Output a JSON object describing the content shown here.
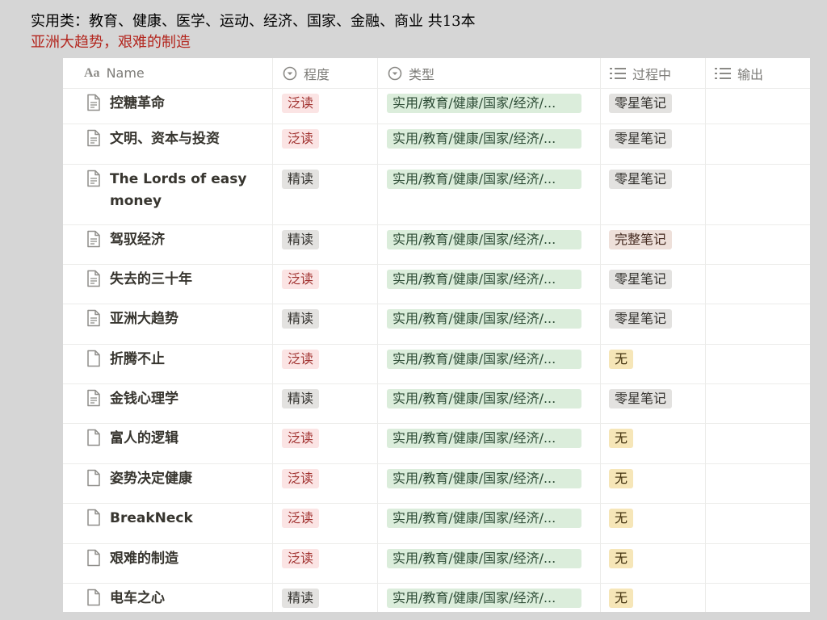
{
  "slide": {
    "title": "实用类：教育、健康、医学、运动、经济、国家、金融、商业 共13本",
    "subtitle": "亚洲大趋势，艰难的制造"
  },
  "columns": {
    "name": "Name",
    "level": "程度",
    "type": "类型",
    "process": "过程中",
    "output": "输出"
  },
  "icons": {
    "name_header": "text-aa-icon",
    "level_header": "select-icon",
    "type_header": "select-icon",
    "process_header": "list-icon",
    "output_header": "list-icon",
    "row": "document-icon"
  },
  "rows": [
    {
      "name": "控糖革命",
      "level": "泛读",
      "type": "实用/教育/健康/国家/经济/...",
      "process": "零星笔记",
      "output": ""
    },
    {
      "name": "文明、资本与投资",
      "level": "泛读",
      "type": "实用/教育/健康/国家/经济/...",
      "process": "零星笔记",
      "output": ""
    },
    {
      "name": "The Lords of easy money",
      "level": "精读",
      "type": "实用/教育/健康/国家/经济/...",
      "process": "零星笔记",
      "output": ""
    },
    {
      "name": "驾驭经济",
      "level": "精读",
      "type": "实用/教育/健康/国家/经济/...",
      "process": "完整笔记",
      "output": ""
    },
    {
      "name": "失去的三十年",
      "level": "泛读",
      "type": "实用/教育/健康/国家/经济/...",
      "process": "零星笔记",
      "output": ""
    },
    {
      "name": "亚洲大趋势",
      "level": "精读",
      "type": "实用/教育/健康/国家/经济/...",
      "process": "零星笔记",
      "output": ""
    },
    {
      "name": "折腾不止",
      "level": "泛读",
      "type": "实用/教育/健康/国家/经济/...",
      "process": "无",
      "output": ""
    },
    {
      "name": "金钱心理学",
      "level": "精读",
      "type": "实用/教育/健康/国家/经济/...",
      "process": "零星笔记",
      "output": ""
    },
    {
      "name": "富人的逻辑",
      "level": "泛读",
      "type": "实用/教育/健康/国家/经济/...",
      "process": "无",
      "output": ""
    },
    {
      "name": "姿势决定健康",
      "level": "泛读",
      "type": "实用/教育/健康/国家/经济/...",
      "process": "无",
      "output": ""
    },
    {
      "name": "BreakNeck",
      "level": "泛读",
      "type": "实用/教育/健康/国家/经济/...",
      "process": "无",
      "output": ""
    },
    {
      "name": "艰难的制造",
      "level": "泛读",
      "type": "实用/教育/健康/国家/经济/...",
      "process": "无",
      "output": ""
    },
    {
      "name": "电车之心",
      "level": "精读",
      "type": "实用/教育/健康/国家/经济/...",
      "process": "无",
      "output": ""
    }
  ],
  "colors": {
    "泛读": "#fbe4e4",
    "精读": "#e3e2e0",
    "type": "#dbeddb",
    "零星笔记": "#e3e2e0",
    "完整笔记": "#eee0da",
    "无": "#f6e6b8"
  }
}
